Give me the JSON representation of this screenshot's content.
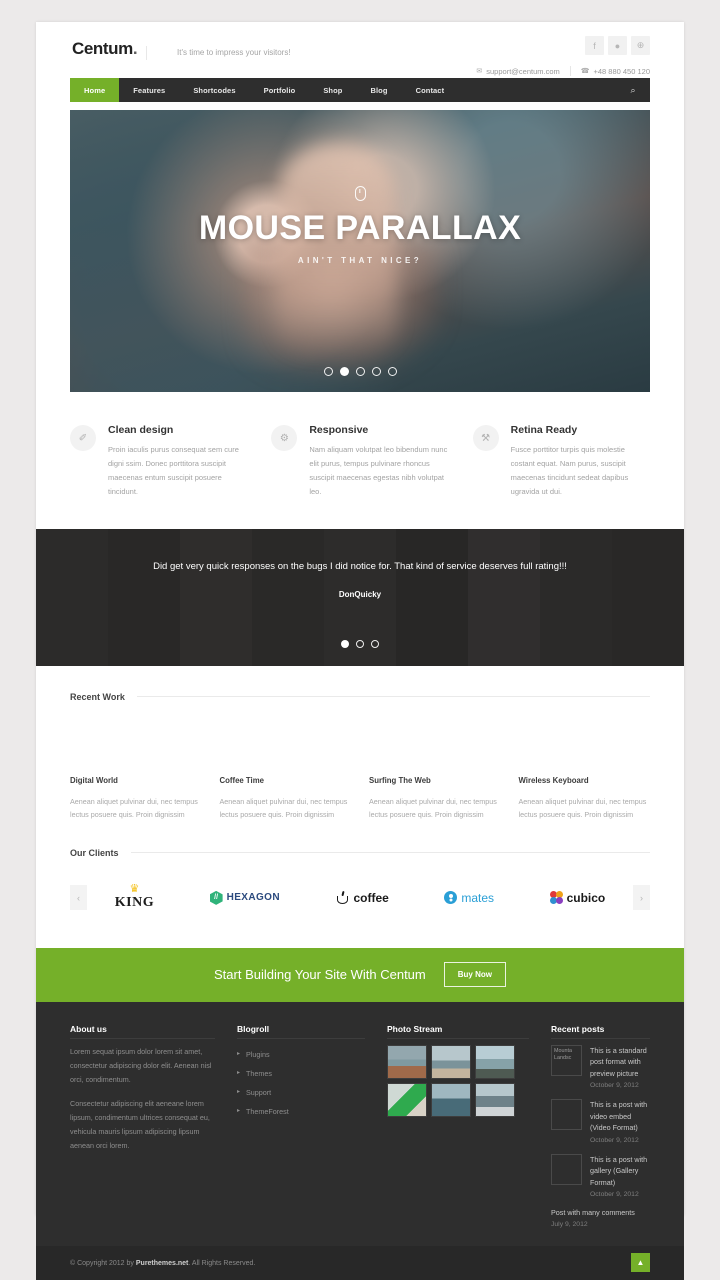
{
  "header": {
    "logo": "Centum",
    "logo_dot": ".",
    "tagline": "It's time to impress your visitors!",
    "socials": [
      {
        "name": "facebook-icon",
        "glyph": "f"
      },
      {
        "name": "dribbble-icon",
        "glyph": "●"
      },
      {
        "name": "google-plus-icon",
        "glyph": "⊕"
      }
    ],
    "email": "support@centum.com",
    "email_icon": "✉",
    "phone": "+48 880 450 120",
    "phone_icon": "☎"
  },
  "nav": {
    "items": [
      {
        "label": "Home",
        "active": true
      },
      {
        "label": "Features",
        "active": false
      },
      {
        "label": "Shortcodes",
        "active": false
      },
      {
        "label": "Portfolio",
        "active": false
      },
      {
        "label": "Shop",
        "active": false
      },
      {
        "label": "Blog",
        "active": false
      },
      {
        "label": "Contact",
        "active": false
      }
    ],
    "search_icon": "⌕",
    "active_color": "#75b029"
  },
  "hero": {
    "title": "MOUSE PARALLAX",
    "subtitle": "AIN'T THAT NICE?",
    "mouse_icon": "mouse-icon",
    "slides_total": 5,
    "active_slide": 2
  },
  "features": [
    {
      "icon": "brush-icon",
      "glyph": "✐",
      "title": "Clean design",
      "text": "Proin iaculis purus consequat sem cure digni ssim. Donec porttitora suscipit maecenas entum suscipit posuere tincidunt."
    },
    {
      "icon": "share-nodes-icon",
      "glyph": "⚙",
      "title": "Responsive",
      "text": "Nam aliquam volutpat leo bibendum nunc elit purus, tempus pulvinare rhoncus suscipit maecenas egestas nibh volutpat leo."
    },
    {
      "icon": "wrench-icon",
      "glyph": "⚒",
      "title": "Retina Ready",
      "text": "Fusce porttitor turpis quis molestie costant equat. Nam purus, suscipit maecenas tincidunt sedeat dapibus ugravida ut dui."
    }
  ],
  "testimonial": {
    "quote": "Did get very quick responses on the bugs I did notice for. That kind of service deserves full rating!!!",
    "author": "DonQuicky",
    "slides_total": 3,
    "active_slide": 1
  },
  "recent_work": {
    "heading": "Recent Work",
    "items": [
      {
        "title": "Digital World",
        "text": "Aenean aliquet pulvinar dui, nec tempus lectus posuere quis. Proin dignissim"
      },
      {
        "title": "Coffee Time",
        "text": "Aenean aliquet pulvinar dui, nec tempus lectus posuere quis. Proin dignissim"
      },
      {
        "title": "Surfing The Web",
        "text": "Aenean aliquet pulvinar dui, nec tempus lectus posuere quis. Proin dignissim"
      },
      {
        "title": "Wireless Keyboard",
        "text": "Aenean aliquet pulvinar dui, nec tempus lectus posuere quis. Proin dignissim"
      }
    ]
  },
  "clients": {
    "heading": "Our Clients",
    "prev_icon": "‹",
    "next_icon": "›",
    "logos": [
      {
        "name": "king-logo",
        "text": "KING"
      },
      {
        "name": "hexagon-logo",
        "text": "HEXAGON"
      },
      {
        "name": "coffee-logo",
        "text": "coffee"
      },
      {
        "name": "mates-logo",
        "text": "mates"
      },
      {
        "name": "cubico-logo",
        "text": "cubico"
      }
    ]
  },
  "cta": {
    "title": "Start Building Your Site With Centum",
    "button": "Buy Now",
    "bg_color": "#75b029"
  },
  "footer": {
    "about": {
      "heading": "About us",
      "p1": "Lorem sequat ipsum dolor lorem sit amet, consectetur adipiscing dolor elit. Aenean nisl orci, condimentum.",
      "p2": "Consectetur adipiscing elit aeneane lorem lipsum, condimentum ultrices consequat eu, vehicula mauris lipsum adipiscing lipsum aenean orci lorem."
    },
    "blogroll": {
      "heading": "Blogroll",
      "links": [
        "Plugins",
        "Themes",
        "Support",
        "ThemeForest"
      ]
    },
    "photo_stream": {
      "heading": "Photo Stream",
      "count": 6
    },
    "recent_posts": {
      "heading": "Recent posts",
      "items": [
        {
          "thumb_alt": "Mounta Landsc",
          "title": "This is a standard post format with preview picture",
          "date": "October 9, 2012"
        },
        {
          "thumb_alt": "",
          "title": "This is a post with video embed (Video Format)",
          "date": "October 9, 2012"
        },
        {
          "thumb_alt": "",
          "title": "This is a post with gallery (Gallery Format)",
          "date": "October 9, 2012"
        }
      ],
      "plain": {
        "title": "Post with many comments",
        "date": "July 9, 2012"
      }
    }
  },
  "copyright": {
    "pre": "© Copyright 2012 by ",
    "brand": "Purethemes.net",
    "post": ". All Rights Reserved.",
    "totop_icon": "▲"
  }
}
